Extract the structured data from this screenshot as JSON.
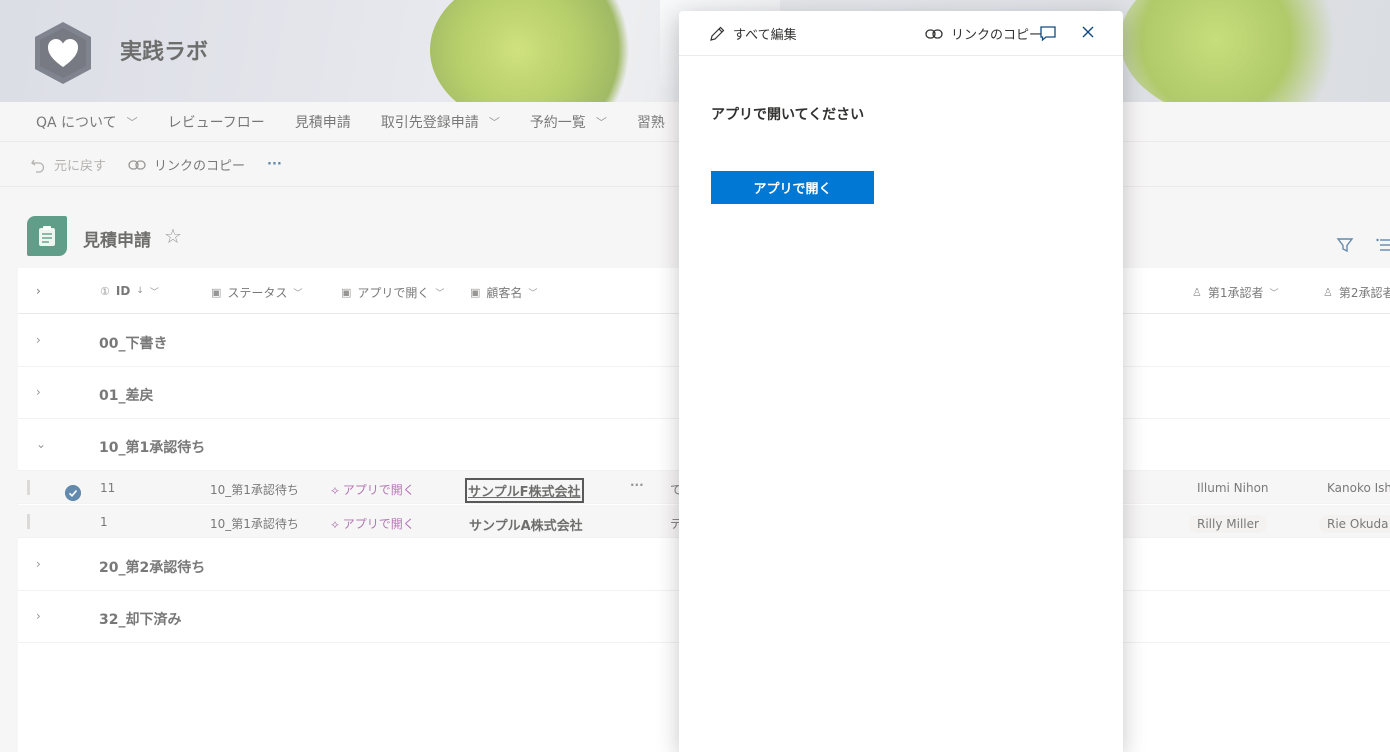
{
  "site": {
    "title": "実践ラボ"
  },
  "nav": {
    "items": [
      {
        "label": "QA について",
        "dropdown": true
      },
      {
        "label": "レビューフロー",
        "dropdown": false
      },
      {
        "label": "見積申請",
        "dropdown": false
      },
      {
        "label": "取引先登録申請",
        "dropdown": true
      },
      {
        "label": "予約一覧",
        "dropdown": true
      },
      {
        "label": "習熟",
        "dropdown": false
      }
    ]
  },
  "commandbar": {
    "undo": "元に戻す",
    "copy_link": "リンクのコピー",
    "more": "···"
  },
  "list": {
    "title": "見積申請",
    "columns": [
      "ID",
      "ステータス",
      "アプリで開く",
      "顧客名",
      "第1承認者",
      "第2承認者"
    ],
    "groups": [
      "00_下書き",
      "01_差戻",
      "10_第1承認待ち",
      "20_第2承認待ち",
      "32_却下済み"
    ],
    "rows": [
      {
        "id": "11",
        "status": "10_第1承認待ち",
        "open": "アプリで開く",
        "customer": "サンプルF株式会社",
        "more": "···",
        "col5": "て",
        "approver1": "Illumi Nihon",
        "approver2": "Kanoko Ishi"
      },
      {
        "id": "1",
        "status": "10_第1承認待ち",
        "open": "アプリで開く",
        "customer": "サンプルA株式会社",
        "more": "",
        "col5": "テ",
        "approver1": "Rilly Miller",
        "approver2": "Rie Okuda"
      }
    ]
  },
  "panel": {
    "edit_all": "すべて編集",
    "copy_link": "リンクのコピー",
    "message": "アプリで開いてください",
    "open_button": "アプリで開く"
  },
  "colors": {
    "accent": "#0078d4",
    "link": "#8a2f8c",
    "list_icon": "#0b6a4a"
  }
}
